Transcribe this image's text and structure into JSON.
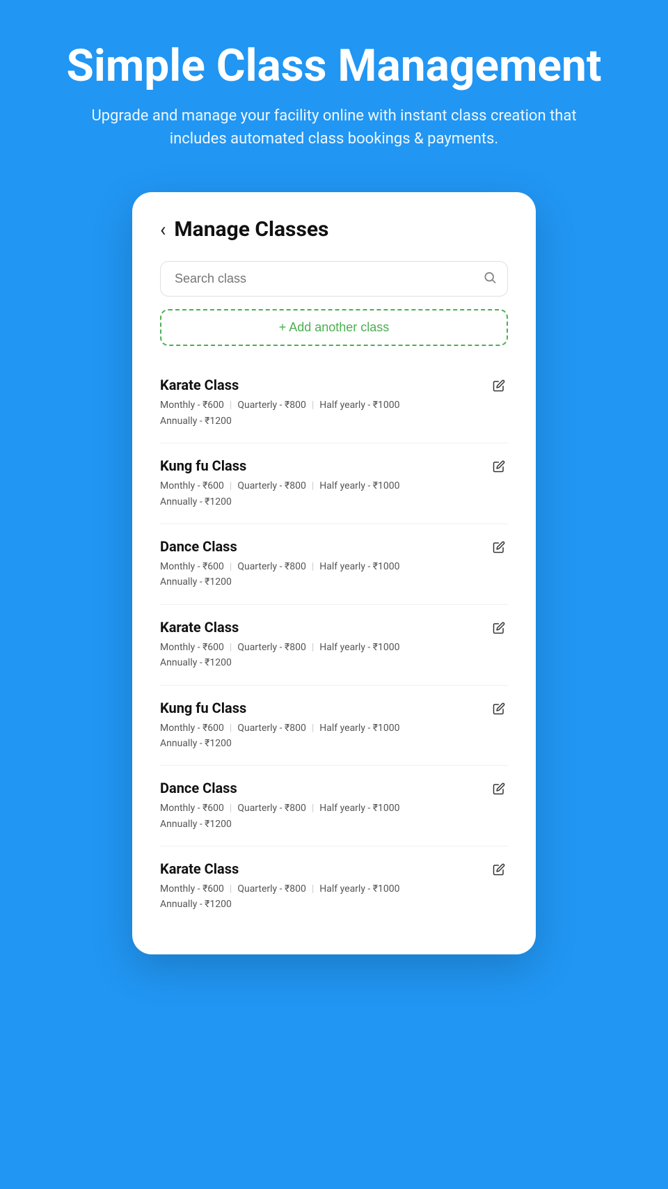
{
  "hero": {
    "title": "Simple Class Management",
    "subtitle": "Upgrade and manage your facility online with instant class creation that includes automated class bookings & payments."
  },
  "card": {
    "back_label": "‹",
    "title": "Manage Classes",
    "search_placeholder": "Search class",
    "add_class_label": "+ Add another class",
    "classes": [
      {
        "name": "Karate Class",
        "monthly": "Monthly - ₹600",
        "quarterly": "Quarterly - ₹800",
        "half_yearly": "Half yearly - ₹1000",
        "annually": "Annually - ₹1200"
      },
      {
        "name": "Kung fu Class",
        "monthly": "Monthly - ₹600",
        "quarterly": "Quarterly - ₹800",
        "half_yearly": "Half yearly - ₹1000",
        "annually": "Annually - ₹1200"
      },
      {
        "name": "Dance Class",
        "monthly": "Monthly - ₹600",
        "quarterly": "Quarterly - ₹800",
        "half_yearly": "Half yearly - ₹1000",
        "annually": "Annually - ₹1200"
      },
      {
        "name": "Karate Class",
        "monthly": "Monthly - ₹600",
        "quarterly": "Quarterly - ₹800",
        "half_yearly": "Half yearly - ₹1000",
        "annually": "Annually - ₹1200"
      },
      {
        "name": "Kung fu Class",
        "monthly": "Monthly - ₹600",
        "quarterly": "Quarterly - ₹800",
        "half_yearly": "Half yearly - ₹1000",
        "annually": "Annually - ₹1200"
      },
      {
        "name": "Dance Class",
        "monthly": "Monthly - ₹600",
        "quarterly": "Quarterly - ₹800",
        "half_yearly": "Half yearly - ₹1000",
        "annually": "Annually - ₹1200"
      },
      {
        "name": "Karate Class",
        "monthly": "Monthly - ₹600",
        "quarterly": "Quarterly - ₹800",
        "half_yearly": "Half yearly - ₹1000",
        "annually": "Annually - ₹1200"
      }
    ]
  }
}
